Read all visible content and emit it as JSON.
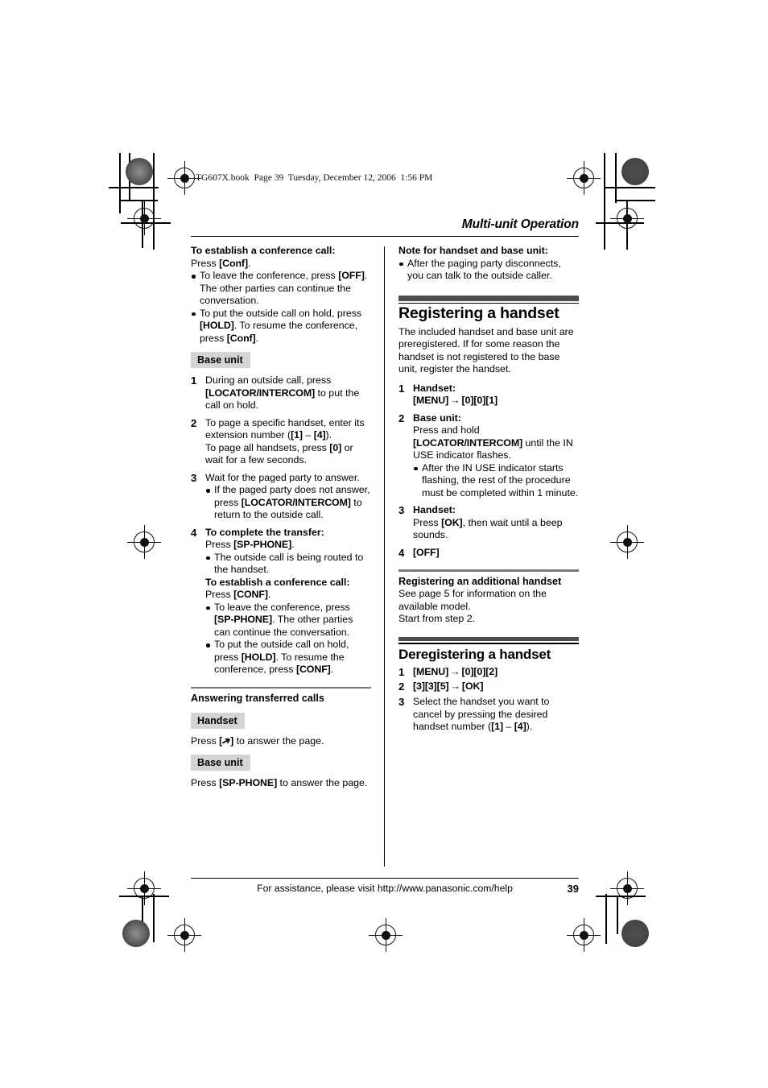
{
  "book_header": "TG607X.book  Page 39  Tuesday, December 12, 2006  1:56 PM",
  "running_head": "Multi-unit Operation",
  "footer": {
    "assistance": "For assistance, please visit http://www.panasonic.com/help",
    "page_number": "39"
  },
  "colors": {
    "badge_bg": "#d4d4d4",
    "section_bar": "#4d4d4d",
    "minor_rule": "#7a7a7a",
    "text": "#000000"
  },
  "left_column": {
    "conference_heading": "To establish a conference call:",
    "conference_press_pre": "Press ",
    "conference_press_key": "[Conf]",
    "conference_press_post": ".",
    "conference_bullets": [
      {
        "part1": "To leave the conference, press ",
        "key1": "[OFF]",
        "part2": ". The other parties can continue the conversation."
      },
      {
        "part1": "To put the outside call on hold, press ",
        "key1": "[HOLD]",
        "part2": ". To resume the conference, press ",
        "key2": "[Conf]",
        "part3": "."
      }
    ],
    "base_unit_badge": "Base unit",
    "steps": [
      {
        "num": "1",
        "lines": [
          {
            "pre": "During an outside call, press ",
            "key": "[LOCATOR/INTERCOM]",
            "post": " to put the call on hold."
          }
        ]
      },
      {
        "num": "2",
        "lines": [
          {
            "pre": "To page a specific handset, enter its extension number (",
            "key": "[1]",
            "mid": " – ",
            "key2": "[4]",
            "post": ")."
          },
          {
            "pre": "To page all handsets, press ",
            "key": "[0]",
            "post": " or wait for a few seconds."
          }
        ]
      },
      {
        "num": "3",
        "text": "Wait for the paged party to answer.",
        "bullets": [
          {
            "pre": "If the paged party does not answer, press ",
            "key": "[LOCATOR/INTERCOM]",
            "post": " to return to the outside call."
          }
        ]
      },
      {
        "num": "4",
        "bold_head": "To complete the transfer:",
        "press_pre": "Press ",
        "press_key": "[SP-PHONE]",
        "press_post": ".",
        "bullets": [
          {
            "text": "The outside call is being routed to the handset."
          }
        ],
        "bold_head2": "To establish a conference call:",
        "press2_pre": "Press ",
        "press2_key": "[CONF]",
        "press2_post": ".",
        "bullets2": [
          {
            "pre": "To leave the conference, press ",
            "key": "[SP-PHONE]",
            "post": ". The other parties can continue the conversation."
          },
          {
            "pre": "To put the outside call on hold, press ",
            "key": "[HOLD]",
            "post": ". To resume the conference, press ",
            "key2": "[CONF]",
            "post2": "."
          }
        ]
      }
    ],
    "answering_title": "Answering transferred calls",
    "handset_badge": "Handset",
    "handset_press_pre": "Press ",
    "handset_press_key_open": "[",
    "handset_press_key_glyph": "➦",
    "handset_press_key_close": "]",
    "handset_press_post": " to answer the page.",
    "base_badge_2": "Base unit",
    "base_press_pre": "Press ",
    "base_press_key": "[SP-PHONE]",
    "base_press_post": " to answer the page."
  },
  "right_column": {
    "note_title": "Note for handset and base unit:",
    "note_bullets": [
      {
        "text": "After the paging party disconnects, you can talk to the outside caller."
      }
    ],
    "section_title": "Registering a handset",
    "section_intro": "The included handset and base unit are preregistered. If for some reason the handset is not registered to the base unit, register the handset.",
    "steps": [
      {
        "num": "1",
        "bold_head": "Handset:",
        "seq": [
          "[MENU]",
          "→",
          "[0][0][1]"
        ]
      },
      {
        "num": "2",
        "bold_head": "Base unit:",
        "pre": "Press and hold ",
        "key": "[LOCATOR/INTERCOM]",
        "post": " until the IN USE indicator flashes.",
        "bullets": [
          {
            "text": "After the IN USE indicator starts flashing, the rest of the procedure must be completed within 1 minute."
          }
        ]
      },
      {
        "num": "3",
        "bold_head": "Handset:",
        "pre": "Press ",
        "key": "[OK]",
        "post": ", then wait until a beep sounds."
      },
      {
        "num": "4",
        "key_only": "[OFF]"
      }
    ],
    "additional_title": "Registering an additional handset",
    "additional_lines": [
      "See page 5 for information on the available model.",
      "Start from step 2."
    ],
    "dereg_title": "Deregistering a handset",
    "dereg_steps": [
      {
        "num": "1",
        "seq": [
          "[MENU]",
          "→",
          "[0][0][2]"
        ]
      },
      {
        "num": "2",
        "seq": [
          "[3][3][5]",
          "→",
          "[OK]"
        ]
      },
      {
        "num": "3",
        "pre": "Select the handset you want to cancel by pressing the desired handset number (",
        "key": "[1]",
        "mid": " – ",
        "key2": "[4]",
        "post": ")."
      }
    ]
  }
}
